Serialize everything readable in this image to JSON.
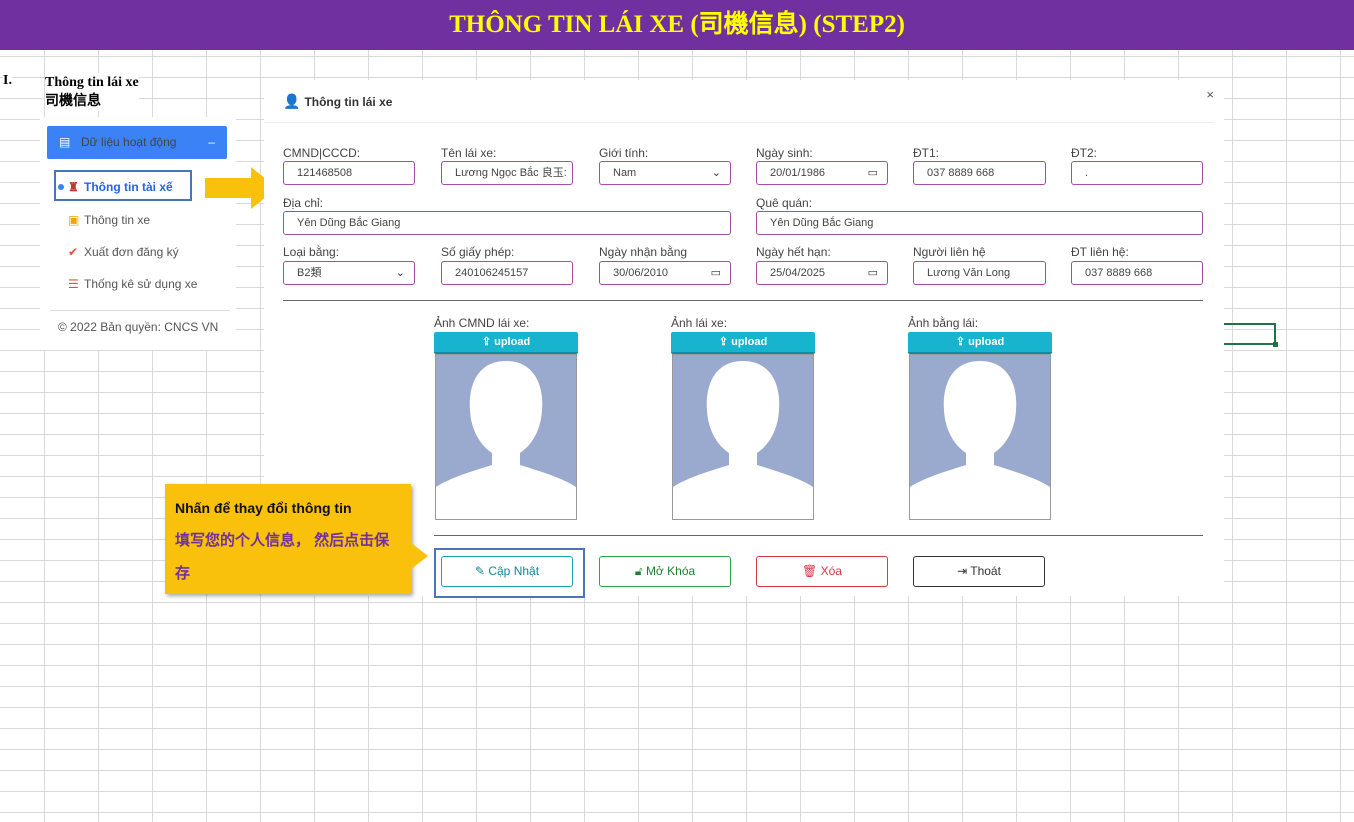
{
  "banner": {
    "title": "THÔNG TIN LÁI XE (司機信息) (STEP2)"
  },
  "section": {
    "number": "I.",
    "title_vi": "Thông tin lái xe",
    "title_zh": "司機信息"
  },
  "sidebar": {
    "header": "Dữ liệu hoạt động",
    "collapse_symbol": "–",
    "items": [
      {
        "label": "Thông tin tài xế",
        "icon": "driver-icon"
      },
      {
        "label": "Thông tin xe",
        "icon": "bus-icon"
      },
      {
        "label": "Xuất đơn đăng ký",
        "icon": "check-icon"
      },
      {
        "label": "Thống kê sử dụng xe",
        "icon": "list-icon"
      }
    ],
    "copyright": "© 2022 Bản quyền: CNCS VN"
  },
  "dialog": {
    "title": "Thông tin lái xe",
    "close": "×",
    "fields": {
      "cmnd": {
        "label": "CMND|CCCD:",
        "value": "121468508"
      },
      "ten": {
        "label": "Tên lái xe:",
        "value": "Lương Ngọc Bắc 良玉:"
      },
      "gioitinh": {
        "label": "Giới tính:",
        "value": "Nam"
      },
      "ngaysinh": {
        "label": "Ngày sinh:",
        "value": "20/01/1986"
      },
      "dt1": {
        "label": "ĐT1:",
        "value": "037 8889 668"
      },
      "dt2": {
        "label": "ĐT2:",
        "value": "."
      },
      "diachi": {
        "label": "Địa chỉ:",
        "value": "Yên Dũng Bắc Giang"
      },
      "quequan": {
        "label": "Quê quán:",
        "value": "Yên Dũng Bắc Giang"
      },
      "loaibang": {
        "label": "Loại bằng:",
        "value": "B2類"
      },
      "sogiayphep": {
        "label": "Số giấy phép:",
        "value": "240106245157"
      },
      "ngaynhan": {
        "label": "Ngày nhận bằng",
        "value": "30/06/2010"
      },
      "ngayhethan": {
        "label": "Ngày hết hạn:",
        "value": "25/04/2025"
      },
      "nguoilienhe": {
        "label": "Người liên hệ",
        "value": "Lương Văn Long"
      },
      "dtlienhe": {
        "label": "ĐT liên hệ:",
        "value": "037 8889 668"
      }
    },
    "photos": [
      {
        "label": "Ảnh CMND lái xe:",
        "upload": "upload"
      },
      {
        "label": "Ảnh lái xe:",
        "upload": "upload"
      },
      {
        "label": "Ảnh bằng lái:",
        "upload": "upload"
      }
    ],
    "buttons": {
      "update": "Cập Nhật",
      "unlock": "Mở Khóa",
      "delete": "Xóa",
      "exit": "Thoát"
    }
  },
  "callout": {
    "line1": "Nhấn để thay đổi thông tin",
    "line2": "填写您的个人信息， 然后点击保存"
  },
  "colors": {
    "banner": "#7030a0",
    "banner_text": "#ffff00",
    "accent": "#3b82f6",
    "upload": "#17b3cf",
    "callout": "#f9c10b"
  }
}
